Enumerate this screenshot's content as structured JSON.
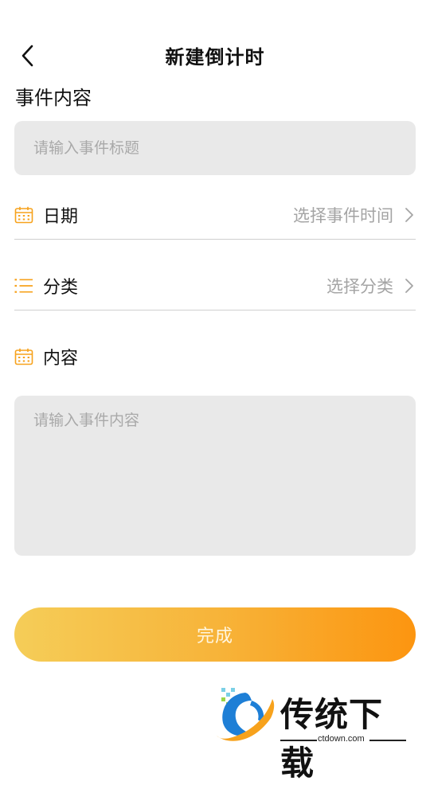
{
  "header": {
    "title": "新建倒计时",
    "back_icon": "chevron-left-icon"
  },
  "event": {
    "section_label": "事件内容",
    "title_placeholder": "请输入事件标题"
  },
  "rows": {
    "date": {
      "label": "日期",
      "value": "选择事件时间",
      "icon": "calendar-icon"
    },
    "category": {
      "label": "分类",
      "value": "选择分类",
      "icon": "list-icon"
    },
    "content": {
      "label": "内容",
      "icon": "calendar-icon"
    }
  },
  "content": {
    "placeholder": "请输入事件内容"
  },
  "submit": {
    "label": "完成"
  },
  "watermark": {
    "text": "传统下载",
    "url": "ctdown.com"
  },
  "colors": {
    "accent": "#f7a21c",
    "input_bg": "#e9e9e9",
    "placeholder": "#a9a9a9",
    "gradient_start": "#f5cd58",
    "gradient_end": "#fc9510"
  }
}
